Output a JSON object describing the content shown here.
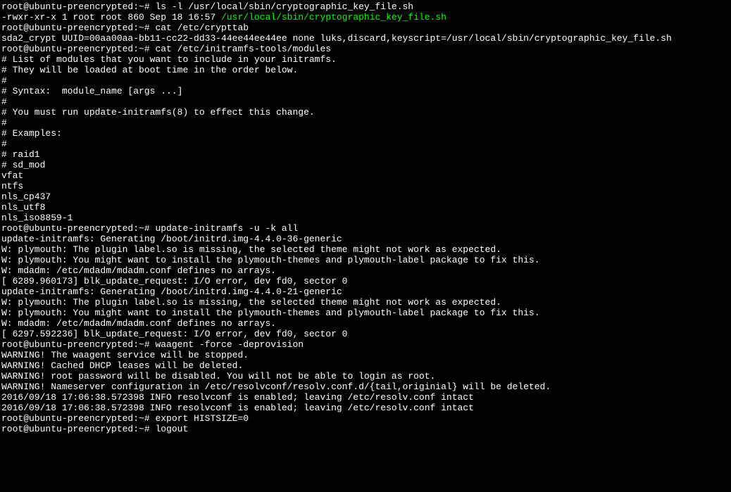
{
  "prompt": "root@ubuntu-preencrypted:~# ",
  "cmd1": "ls -l /usr/local/sbin/cryptographic_key_file.sh",
  "ls_perms": "-rwxr-xr-x 1 root root 860 Sep 18 16:57 ",
  "ls_path": "/usr/local/sbin/cryptographic_key_file.sh",
  "cmd2": "cat /etc/crypttab",
  "crypttab_line": "sda2_crypt UUID=00aa00aa-bb11-cc22-dd33-44ee44ee44ee none luks,discard,keyscript=/usr/local/sbin/cryptographic_key_file.sh",
  "cmd3": "cat /etc/initramfs-tools/modules",
  "mod1": "# List of modules that you want to include in your initramfs.",
  "mod2": "# They will be loaded at boot time in the order below.",
  "mod3": "#",
  "mod4": "# Syntax:  module_name [args ...]",
  "mod5": "#",
  "mod6": "# You must run update-initramfs(8) to effect this change.",
  "mod7": "#",
  "mod8": "# Examples:",
  "mod9": "#",
  "mod10": "# raid1",
  "mod11": "# sd_mod",
  "mod12": "vfat",
  "mod13": "ntfs",
  "mod14": "nls_cp437",
  "mod15": "nls_utf8",
  "mod16": "nls_iso8859-1",
  "cmd4": "update-initramfs -u -k all",
  "u1": "update-initramfs: Generating /boot/initrd.img-4.4.0-36-generic",
  "u2": "W: plymouth: The plugin label.so is missing, the selected theme might not work as expected.",
  "u3": "W: plymouth: You might want to install the plymouth-themes and plymouth-label package to fix this.",
  "u4": "W: mdadm: /etc/mdadm/mdadm.conf defines no arrays.",
  "u5": "[ 6289.960173] blk_update_request: I/O error, dev fd0, sector 0",
  "u6": "update-initramfs: Generating /boot/initrd.img-4.4.0-21-generic",
  "u7": "W: plymouth: The plugin label.so is missing, the selected theme might not work as expected.",
  "u8": "W: plymouth: You might want to install the plymouth-themes and plymouth-label package to fix this.",
  "u9": "W: mdadm: /etc/mdadm/mdadm.conf defines no arrays.",
  "u10": "[ 6297.592236] blk_update_request: I/O error, dev fd0, sector 0",
  "cmd5": "waagent -force -deprovision",
  "w1": "WARNING! The waagent service will be stopped.",
  "w2": "WARNING! Cached DHCP leases will be deleted.",
  "w3": "WARNING! root password will be disabled. You will not be able to login as root.",
  "w4": "WARNING! Nameserver configuration in /etc/resolvconf/resolv.conf.d/{tail,originial} will be deleted.",
  "w5": "2016/09/18 17:06:38.572398 INFO resolvconf is enabled; leaving /etc/resolv.conf intact",
  "w6": "2016/09/18 17:06:38.572398 INFO resolvconf is enabled; leaving /etc/resolv.conf intact",
  "cmd6": "export HISTSIZE=0",
  "cmd7": "logout"
}
